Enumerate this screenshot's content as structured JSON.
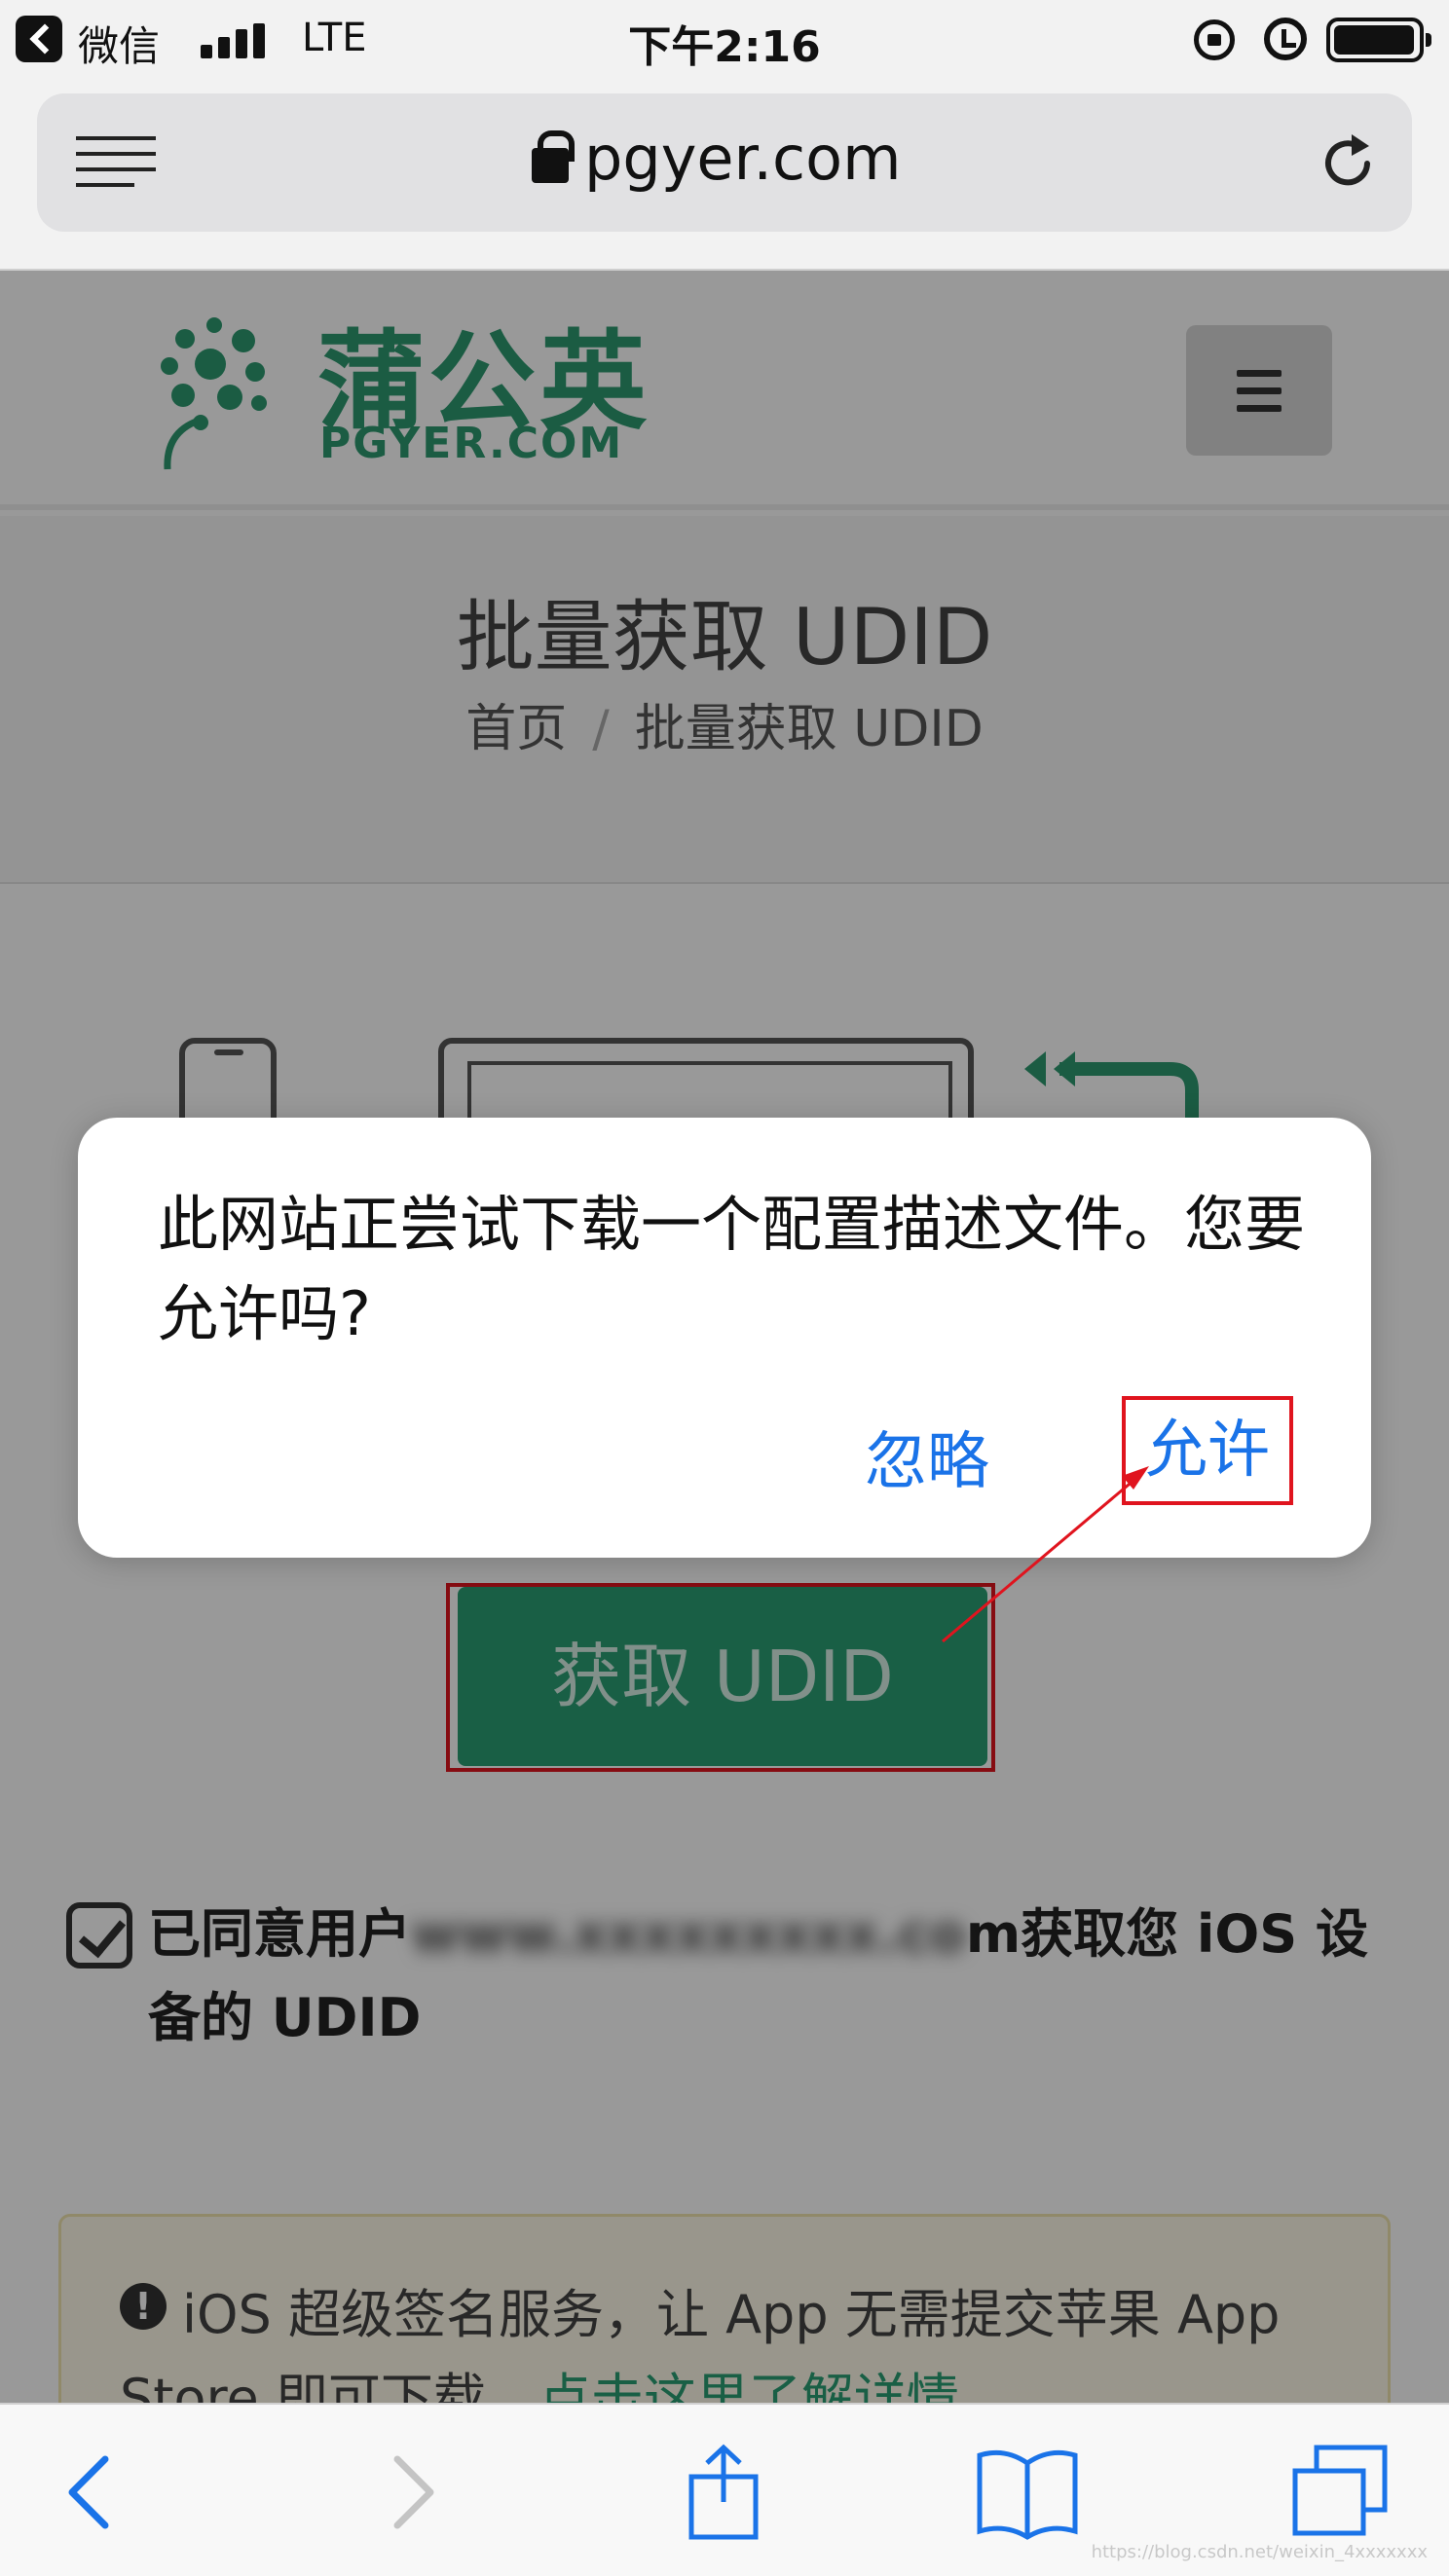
{
  "status_bar": {
    "app_name": "微信",
    "network": "LTE",
    "time": "下午2:16"
  },
  "address_bar": {
    "url": "pgyer.com"
  },
  "site": {
    "logo_cn": "蒲公英",
    "logo_en": "PGYER.COM",
    "brand_color": "#2e9a71",
    "page_title": "批量获取 UDID",
    "breadcrumb": {
      "home": "首页",
      "separator": "/",
      "current": "批量获取 UDID"
    },
    "get_udid_button": "获取 UDID",
    "consent": {
      "prefix": "已同意用户",
      "blurred_email": "www.xxxxxxxxx.co",
      "suffix": "m获取您 iOS 设备的 UDID",
      "checked": true
    },
    "notice": {
      "line1": "iOS 超级签名服务，让 App 无需提交苹果 App",
      "line2_prefix": "Store 即可下载，",
      "link": "点击这里了解详情"
    }
  },
  "dialog": {
    "message": "此网站正尝试下载一个配置描述文件。您要允许吗?",
    "ignore_label": "忽略",
    "allow_label": "允许",
    "accent_color": "#1a73e8"
  },
  "toolbar": {
    "icons": [
      "back-icon",
      "forward-icon",
      "share-icon",
      "bookmarks-icon",
      "tabs-icon"
    ]
  },
  "watermark": "https://blog.csdn.net/weixin_4xxxxxxx"
}
